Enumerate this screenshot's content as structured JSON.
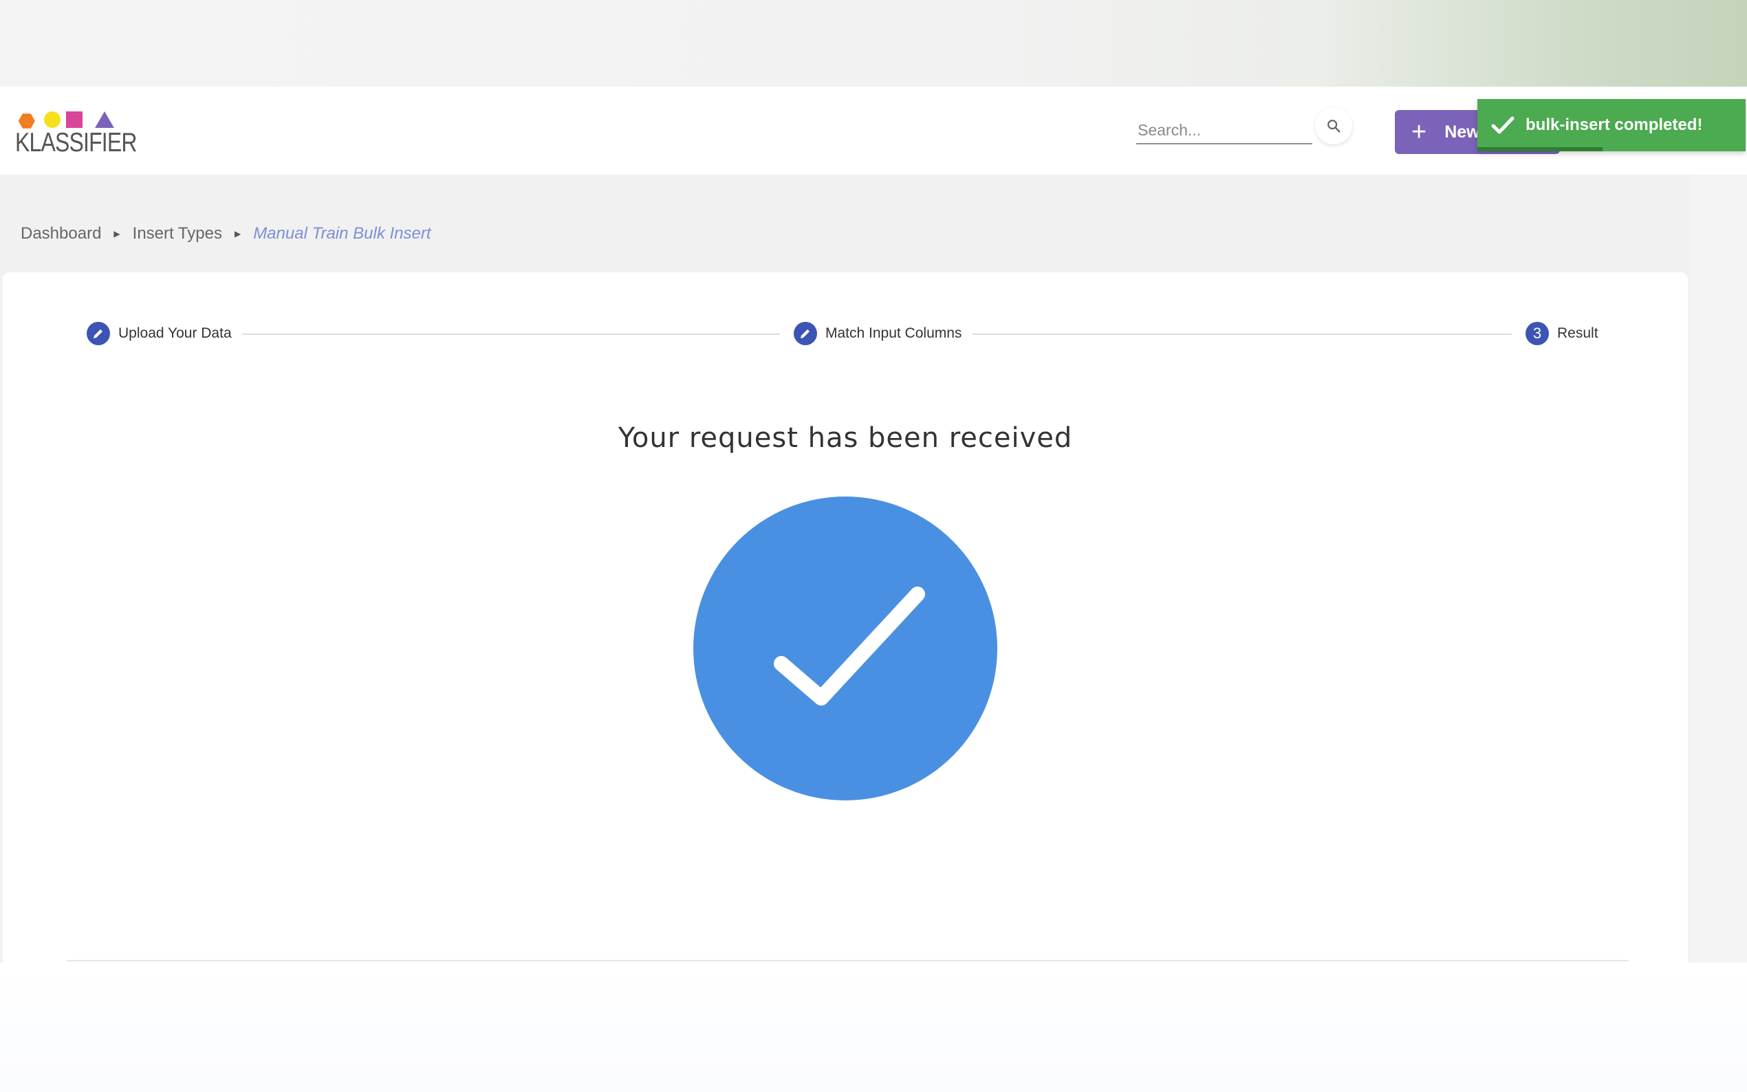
{
  "app": {
    "logo_text": "KLASSIFIER"
  },
  "header": {
    "search_placeholder": "Search...",
    "new_button_label": "New"
  },
  "toast": {
    "message": "bulk-insert completed!"
  },
  "breadcrumb": {
    "items": [
      "Dashboard",
      "Insert Types"
    ],
    "current": "Manual Train Bulk Insert"
  },
  "stepper": {
    "steps": [
      {
        "label": "Upload Your Data",
        "status": "completed"
      },
      {
        "label": "Match Input Columns",
        "status": "completed"
      },
      {
        "label": "Result",
        "number": "3",
        "status": "active"
      }
    ]
  },
  "result": {
    "title": "Your request has been received"
  },
  "colors": {
    "primary": "#3c54b3",
    "new_button": "#7b63b9",
    "toast_success": "#4caa50",
    "check_circle": "#4a90e2",
    "breadcrumb_current": "#7b8fd6"
  }
}
